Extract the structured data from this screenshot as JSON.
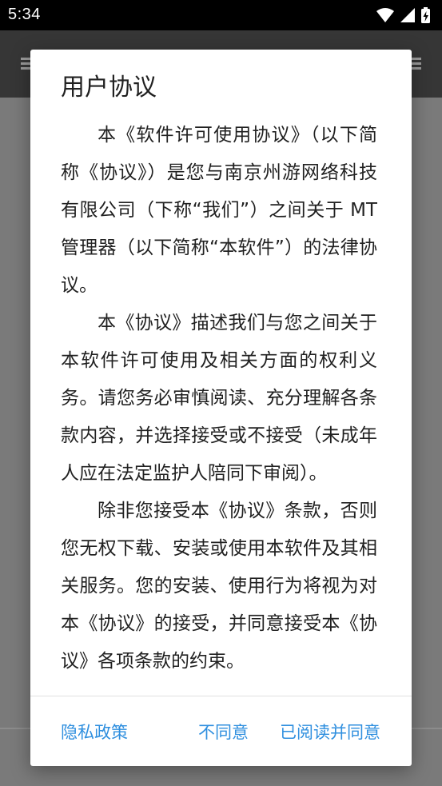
{
  "status_bar": {
    "time": "5:34",
    "icons": [
      "wifi-icon",
      "signal-icon",
      "battery-charging-icon"
    ]
  },
  "app_bar": {
    "left_icon": "menu-icon",
    "right_icon": "more-icon"
  },
  "dialog": {
    "title": "用户协议",
    "paragraphs": [
      "本《软件许可使用协议》（以下简称《协议》）是您与南京州游网络科技有限公司（下称“我们”）之间关于 MT 管理器（以下简称“本软件”）的法律协议。",
      "本《协议》描述我们与您之间关于本软件许可使用及相关方面的权利义务。请您务必审慎阅读、充分理解各条款内容，并选择接受或不接受（未成年人应在法定监护人陪同下审阅）。",
      "除非您接受本《协议》条款，否则您无权下载、安装或使用本软件及其相关服务。您的安装、使用行为将视为对本《协议》的接受，并同意接受本《协议》各项条款的约束。"
    ],
    "actions": {
      "privacy": "隐私政策",
      "disagree": "不同意",
      "agree": "已阅读并同意"
    }
  },
  "colors": {
    "accent": "#2f8fdf",
    "title_text": "#212121",
    "scrim": "#6e6e6e",
    "app_bar": "#363636"
  }
}
